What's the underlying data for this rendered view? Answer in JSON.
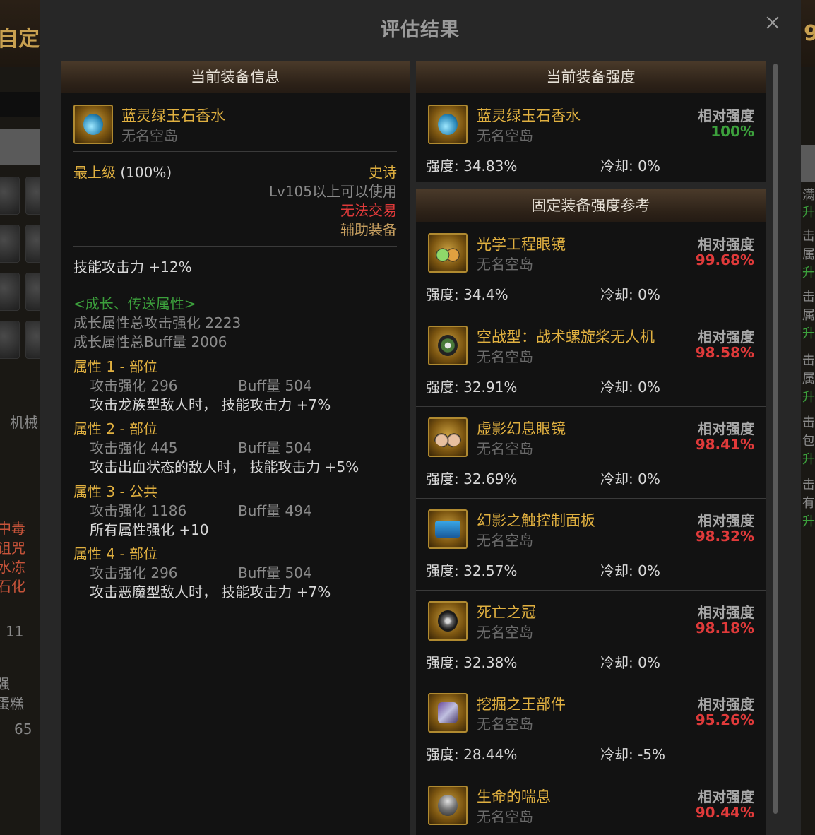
{
  "background": {
    "title_left": "自定义",
    "title_right": "9",
    "left_texts": [
      "机械",
      "中毒",
      "诅咒",
      "水冻",
      "石化",
      "11",
      "强",
      "蛋糕",
      "65"
    ],
    "right_texts": [
      "满",
      "升",
      "击",
      "属",
      "升",
      "击",
      "属",
      "升",
      "击",
      "属",
      "升",
      "击",
      "包",
      "升",
      "击",
      "有",
      "升"
    ]
  },
  "modal": {
    "title": "评估结果",
    "left_panel": {
      "header": "当前装备信息",
      "item": {
        "name": "蓝灵绿玉石香水",
        "source": "无名空岛",
        "icon": "perfume-icon"
      },
      "grade_label": "最上级",
      "grade_pct": "(100%)",
      "rarity": "史诗",
      "level_req": "Lv105以上可以使用",
      "trade": "无法交易",
      "slot": "辅助装备",
      "skill_attack": "技能攻击力   +12%",
      "growth_header": "<成长、传送属性>",
      "growth_total_atk": "成长属性总攻击强化 2223",
      "growth_total_buff": "成长属性总Buff量 2006",
      "attributes": [
        {
          "title": "属性 1 - 部位",
          "atk": "攻击强化   296",
          "buff": "Buff量   504",
          "effect": "攻击龙族型敌人时，  技能攻击力 +7%"
        },
        {
          "title": "属性 2 - 部位",
          "atk": "攻击强化   445",
          "buff": "Buff量   504",
          "effect": "攻击出血状态的敌人时，  技能攻击力 +5%"
        },
        {
          "title": "属性 3 - 公共",
          "atk": "攻击强化   1186",
          "buff": "Buff量   494",
          "effect": "所有属性强化 +10"
        },
        {
          "title": "属性 4 - 部位",
          "atk": "攻击强化   296",
          "buff": "Buff量   504",
          "effect": "攻击恶魔型敌人时，  技能攻击力 +7%"
        }
      ]
    },
    "current_panel": {
      "header": "当前装备强度",
      "item": {
        "name": "蓝灵绿玉石香水",
        "source": "无名空岛",
        "rel_label": "相对强度",
        "rel_value": "100%",
        "strength": "强度: 34.83%",
        "cooldown": "冷却: 0%"
      }
    },
    "reference_panel": {
      "header": "固定装备强度参考",
      "items": [
        {
          "name": "光学工程眼镜",
          "source": "无名空岛",
          "rel_label": "相对强度",
          "rel_value": "99.68%",
          "strength": "强度: 34.4%",
          "cooldown": "冷却: 0%"
        },
        {
          "name": "空战型：战术螺旋桨无人机",
          "source": "无名空岛",
          "rel_label": "相对强度",
          "rel_value": "98.58%",
          "strength": "强度: 32.91%",
          "cooldown": "冷却: 0%"
        },
        {
          "name": "虚影幻息眼镜",
          "source": "无名空岛",
          "rel_label": "相对强度",
          "rel_value": "98.41%",
          "strength": "强度: 32.69%",
          "cooldown": "冷却: 0%"
        },
        {
          "name": "幻影之触控制面板",
          "source": "无名空岛",
          "rel_label": "相对强度",
          "rel_value": "98.32%",
          "strength": "强度: 32.57%",
          "cooldown": "冷却: 0%"
        },
        {
          "name": "死亡之冠",
          "source": "无名空岛",
          "rel_label": "相对强度",
          "rel_value": "98.18%",
          "strength": "强度: 32.38%",
          "cooldown": "冷却: 0%"
        },
        {
          "name": "挖掘之王部件",
          "source": "无名空岛",
          "rel_label": "相对强度",
          "rel_value": "95.26%",
          "strength": "强度: 28.44%",
          "cooldown": "冷却: -5%"
        },
        {
          "name": "生命的喘息",
          "source": "无名空岛",
          "rel_label": "相对强度",
          "rel_value": "90.44%",
          "strength": "",
          "cooldown": ""
        }
      ]
    }
  },
  "colors": {
    "gold": "#e0b040",
    "red": "#e03a3a",
    "green": "#3ca03c",
    "modal_bg": "#272727",
    "panel_bg": "#121212"
  }
}
